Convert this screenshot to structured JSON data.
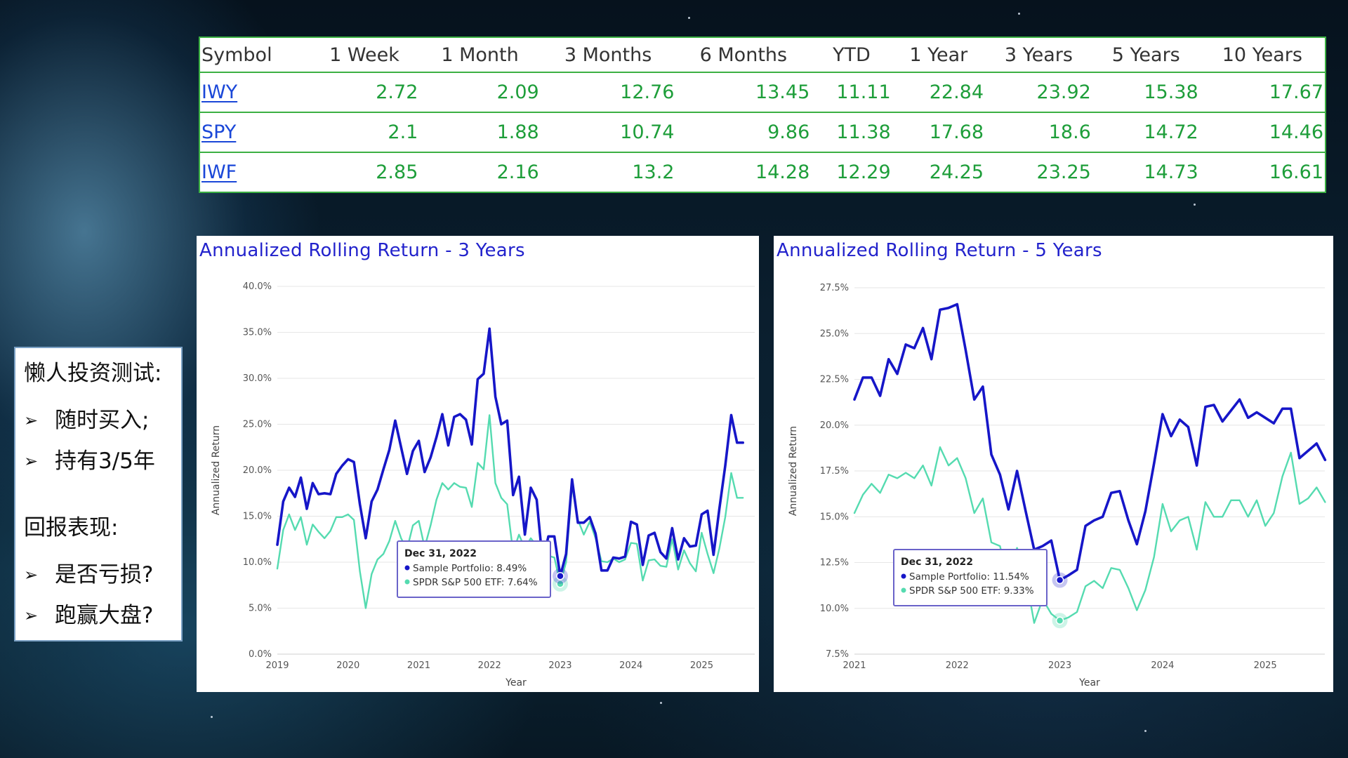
{
  "table": {
    "headers": [
      "Symbol",
      "1 Week",
      "1 Month",
      "3 Months",
      "6 Months",
      "YTD",
      "1 Year",
      "3 Years",
      "5 Years",
      "10 Years"
    ],
    "rows": [
      {
        "symbol": "IWY",
        "values": [
          "2.72",
          "2.09",
          "12.76",
          "13.45",
          "11.11",
          "22.84",
          "23.92",
          "15.38",
          "17.67"
        ]
      },
      {
        "symbol": "SPY",
        "values": [
          "2.1",
          "1.88",
          "10.74",
          "9.86",
          "11.38",
          "17.68",
          "18.6",
          "14.72",
          "14.46"
        ]
      },
      {
        "symbol": "IWF",
        "values": [
          "2.85",
          "2.16",
          "13.2",
          "14.28",
          "12.29",
          "24.25",
          "23.25",
          "14.73",
          "16.61"
        ]
      }
    ]
  },
  "lazy_card": {
    "heading1": "懒人投资测试:",
    "item1": "随时买入;",
    "item2": "持有3/5年",
    "heading2": "回报表现:",
    "item3": "是否亏损?",
    "item4": "跑赢大盘?",
    "bullet": "➢"
  },
  "colors": {
    "portfolio": "#1616c8",
    "etf": "#55dbb0",
    "table_border": "#3cb043",
    "table_values": "#1e9e3a",
    "link": "#1a47d8",
    "title": "#2222cc"
  },
  "chart_data": [
    {
      "type": "line",
      "title": "Annualized Rolling Return - 3 Years",
      "xlabel": "Year",
      "ylabel": "Annualized Return",
      "xlim": [
        2019.0,
        2025.75
      ],
      "ylim": [
        0,
        40
      ],
      "yticks": [
        "0.0%",
        "5.0%",
        "10.0%",
        "15.0%",
        "20.0%",
        "25.0%",
        "30.0%",
        "35.0%",
        "40.0%"
      ],
      "xticks": [
        "2019",
        "2020",
        "2021",
        "2022",
        "2023",
        "2024",
        "2025"
      ],
      "grid": true,
      "tooltip": {
        "date": "Dec 31, 2022",
        "line1": "Sample Portfolio: 8.49%",
        "line2": "SPDR S&P 500 ETF: 7.64%",
        "x": 2023.0,
        "y1": 8.49,
        "y2": 7.64
      },
      "series": [
        {
          "name": "Sample Portfolio",
          "x": [
            2019.0,
            2019.083,
            2019.167,
            2019.25,
            2019.333,
            2019.417,
            2019.5,
            2019.583,
            2019.667,
            2019.75,
            2019.833,
            2019.917,
            2020.0,
            2020.083,
            2020.167,
            2020.25,
            2020.333,
            2020.417,
            2020.5,
            2020.583,
            2020.667,
            2020.75,
            2020.833,
            2020.917,
            2021.0,
            2021.083,
            2021.167,
            2021.25,
            2021.333,
            2021.417,
            2021.5,
            2021.583,
            2021.667,
            2021.75,
            2021.833,
            2021.917,
            2022.0,
            2022.083,
            2022.167,
            2022.25,
            2022.333,
            2022.417,
            2022.5,
            2022.583,
            2022.667,
            2022.75,
            2022.833,
            2022.917,
            2023.0,
            2023.083,
            2023.167,
            2023.25,
            2023.333,
            2023.417,
            2023.5,
            2023.583,
            2023.667,
            2023.75,
            2023.833,
            2023.917,
            2024.0,
            2024.083,
            2024.167,
            2024.25,
            2024.333,
            2024.417,
            2024.5,
            2024.583,
            2024.667,
            2024.75,
            2024.833,
            2024.917,
            2025.0,
            2025.083,
            2025.167,
            2025.25,
            2025.333,
            2025.417,
            2025.5,
            2025.583
          ],
          "values": [
            11.9,
            16.6,
            18.1,
            17.1,
            19.2,
            15.8,
            18.6,
            17.4,
            17.5,
            17.4,
            19.6,
            20.5,
            21.2,
            20.9,
            16.3,
            12.6,
            16.6,
            17.9,
            20.1,
            22.2,
            25.4,
            22.5,
            19.6,
            22.1,
            23.2,
            19.8,
            21.4,
            23.6,
            26.1,
            22.7,
            25.8,
            26.1,
            25.5,
            22.8,
            29.9,
            30.5,
            35.4,
            28.0,
            25.0,
            25.4,
            17.3,
            19.3,
            13.0,
            18.1,
            16.8,
            10.1,
            12.8,
            12.8,
            8.49,
            10.9,
            19.0,
            14.3,
            14.3,
            14.9,
            13.1,
            9.1,
            9.1,
            10.5,
            10.4,
            10.6,
            14.4,
            14.1,
            9.7,
            12.9,
            13.2,
            11.1,
            10.4,
            13.7,
            10.3,
            12.6,
            11.7,
            11.8,
            15.2,
            15.6,
            10.8,
            15.8,
            20.5,
            26.0,
            23.0,
            23.0
          ]
        },
        {
          "name": "SPDR S&P 500 ETF",
          "x": [
            2019.0,
            2019.083,
            2019.167,
            2019.25,
            2019.333,
            2019.417,
            2019.5,
            2019.583,
            2019.667,
            2019.75,
            2019.833,
            2019.917,
            2020.0,
            2020.083,
            2020.167,
            2020.25,
            2020.333,
            2020.417,
            2020.5,
            2020.583,
            2020.667,
            2020.75,
            2020.833,
            2020.917,
            2021.0,
            2021.083,
            2021.167,
            2021.25,
            2021.333,
            2021.417,
            2021.5,
            2021.583,
            2021.667,
            2021.75,
            2021.833,
            2021.917,
            2022.0,
            2022.083,
            2022.167,
            2022.25,
            2022.333,
            2022.417,
            2022.5,
            2022.583,
            2022.667,
            2022.75,
            2022.833,
            2022.917,
            2023.0,
            2023.083,
            2023.167,
            2023.25,
            2023.333,
            2023.417,
            2023.5,
            2023.583,
            2023.667,
            2023.75,
            2023.833,
            2023.917,
            2024.0,
            2024.083,
            2024.167,
            2024.25,
            2024.333,
            2024.417,
            2024.5,
            2024.583,
            2024.667,
            2024.75,
            2024.833,
            2024.917,
            2025.0,
            2025.083,
            2025.167,
            2025.25,
            2025.333,
            2025.417,
            2025.5,
            2025.583
          ],
          "values": [
            9.3,
            13.5,
            15.2,
            13.5,
            14.9,
            11.9,
            14.1,
            13.3,
            12.6,
            13.4,
            14.9,
            14.9,
            15.2,
            14.6,
            9.0,
            5.0,
            8.7,
            10.3,
            10.9,
            12.3,
            14.5,
            12.6,
            11.4,
            14.0,
            14.5,
            11.6,
            14.0,
            16.8,
            18.6,
            17.9,
            18.6,
            18.2,
            18.1,
            16.0,
            20.8,
            20.1,
            26.0,
            18.6,
            17.0,
            16.3,
            11.1,
            13.0,
            11.5,
            12.6,
            11.8,
            9.2,
            10.7,
            10.5,
            7.64,
            10.0,
            18.3,
            14.6,
            13.0,
            14.4,
            12.6,
            10.1,
            10.0,
            10.4,
            10.0,
            10.3,
            12.1,
            12.0,
            8.0,
            10.2,
            10.3,
            9.6,
            9.5,
            12.5,
            9.2,
            11.3,
            9.9,
            9.0,
            13.2,
            10.9,
            8.8,
            11.5,
            14.9,
            19.7,
            17.0,
            17.0
          ]
        }
      ]
    },
    {
      "type": "line",
      "title": "Annualized Rolling Return - 5 Years",
      "xlabel": "Year",
      "ylabel": "Annualized Return",
      "xlim": [
        2021.0,
        2025.58
      ],
      "ylim": [
        7.5,
        27.5
      ],
      "yticks": [
        "7.5%",
        "10.0%",
        "12.5%",
        "15.0%",
        "17.5%",
        "20.0%",
        "22.5%",
        "25.0%",
        "27.5%"
      ],
      "xticks": [
        "2021",
        "2022",
        "2023",
        "2024",
        "2025"
      ],
      "grid": true,
      "tooltip": {
        "date": "Dec 31, 2022",
        "line1": "Sample Portfolio: 11.54%",
        "line2": "SPDR S&P 500 ETF: 9.33%",
        "x": 2023.0,
        "y1": 11.54,
        "y2": 9.33
      },
      "series": [
        {
          "name": "Sample Portfolio",
          "x": [
            2021.0,
            2021.083,
            2021.167,
            2021.25,
            2021.333,
            2021.417,
            2021.5,
            2021.583,
            2021.667,
            2021.75,
            2021.833,
            2021.917,
            2022.0,
            2022.083,
            2022.167,
            2022.25,
            2022.333,
            2022.417,
            2022.5,
            2022.583,
            2022.667,
            2022.75,
            2022.833,
            2022.917,
            2023.0,
            2023.083,
            2023.167,
            2023.25,
            2023.333,
            2023.417,
            2023.5,
            2023.583,
            2023.667,
            2023.75,
            2023.833,
            2023.917,
            2024.0,
            2024.083,
            2024.167,
            2024.25,
            2024.333,
            2024.417,
            2024.5,
            2024.583,
            2024.667,
            2024.75,
            2024.833,
            2024.917,
            2025.0,
            2025.083,
            2025.167,
            2025.25,
            2025.333,
            2025.417,
            2025.5,
            2025.583
          ],
          "values": [
            21.4,
            22.6,
            22.6,
            21.6,
            23.6,
            22.8,
            24.4,
            24.2,
            25.3,
            23.6,
            26.3,
            26.4,
            26.6,
            24.1,
            21.4,
            22.1,
            18.4,
            17.3,
            15.4,
            17.5,
            15.3,
            13.2,
            13.4,
            13.7,
            11.54,
            11.8,
            12.1,
            14.5,
            14.8,
            15.0,
            16.3,
            16.4,
            14.8,
            13.5,
            15.3,
            17.9,
            20.6,
            19.4,
            20.3,
            19.9,
            17.8,
            21.0,
            21.1,
            20.2,
            20.8,
            21.4,
            20.4,
            20.7,
            20.4,
            20.1,
            20.9,
            20.9,
            18.2,
            18.6,
            19.0,
            18.1
          ]
        },
        {
          "name": "SPDR S&P 500 ETF",
          "x": [
            2021.0,
            2021.083,
            2021.167,
            2021.25,
            2021.333,
            2021.417,
            2021.5,
            2021.583,
            2021.667,
            2021.75,
            2021.833,
            2021.917,
            2022.0,
            2022.083,
            2022.167,
            2022.25,
            2022.333,
            2022.417,
            2022.5,
            2022.583,
            2022.667,
            2022.75,
            2022.833,
            2022.917,
            2023.0,
            2023.083,
            2023.167,
            2023.25,
            2023.333,
            2023.417,
            2023.5,
            2023.583,
            2023.667,
            2023.75,
            2023.833,
            2023.917,
            2024.0,
            2024.083,
            2024.167,
            2024.25,
            2024.333,
            2024.417,
            2024.5,
            2024.583,
            2024.667,
            2024.75,
            2024.833,
            2024.917,
            2025.0,
            2025.083,
            2025.167,
            2025.25,
            2025.333,
            2025.417,
            2025.5,
            2025.583
          ],
          "values": [
            15.2,
            16.2,
            16.8,
            16.3,
            17.3,
            17.1,
            17.4,
            17.1,
            17.8,
            16.7,
            18.8,
            17.8,
            18.2,
            17.1,
            15.2,
            16.0,
            13.6,
            13.4,
            11.5,
            13.3,
            11.8,
            9.2,
            10.5,
            9.7,
            9.33,
            9.5,
            9.8,
            11.2,
            11.5,
            11.1,
            12.2,
            12.1,
            11.1,
            9.9,
            11.0,
            12.8,
            15.7,
            14.2,
            14.8,
            15.0,
            13.2,
            15.8,
            15.0,
            15.0,
            15.9,
            15.9,
            15.0,
            15.9,
            14.5,
            15.2,
            17.2,
            18.5,
            15.7,
            16.0,
            16.6,
            15.8
          ]
        }
      ]
    }
  ]
}
